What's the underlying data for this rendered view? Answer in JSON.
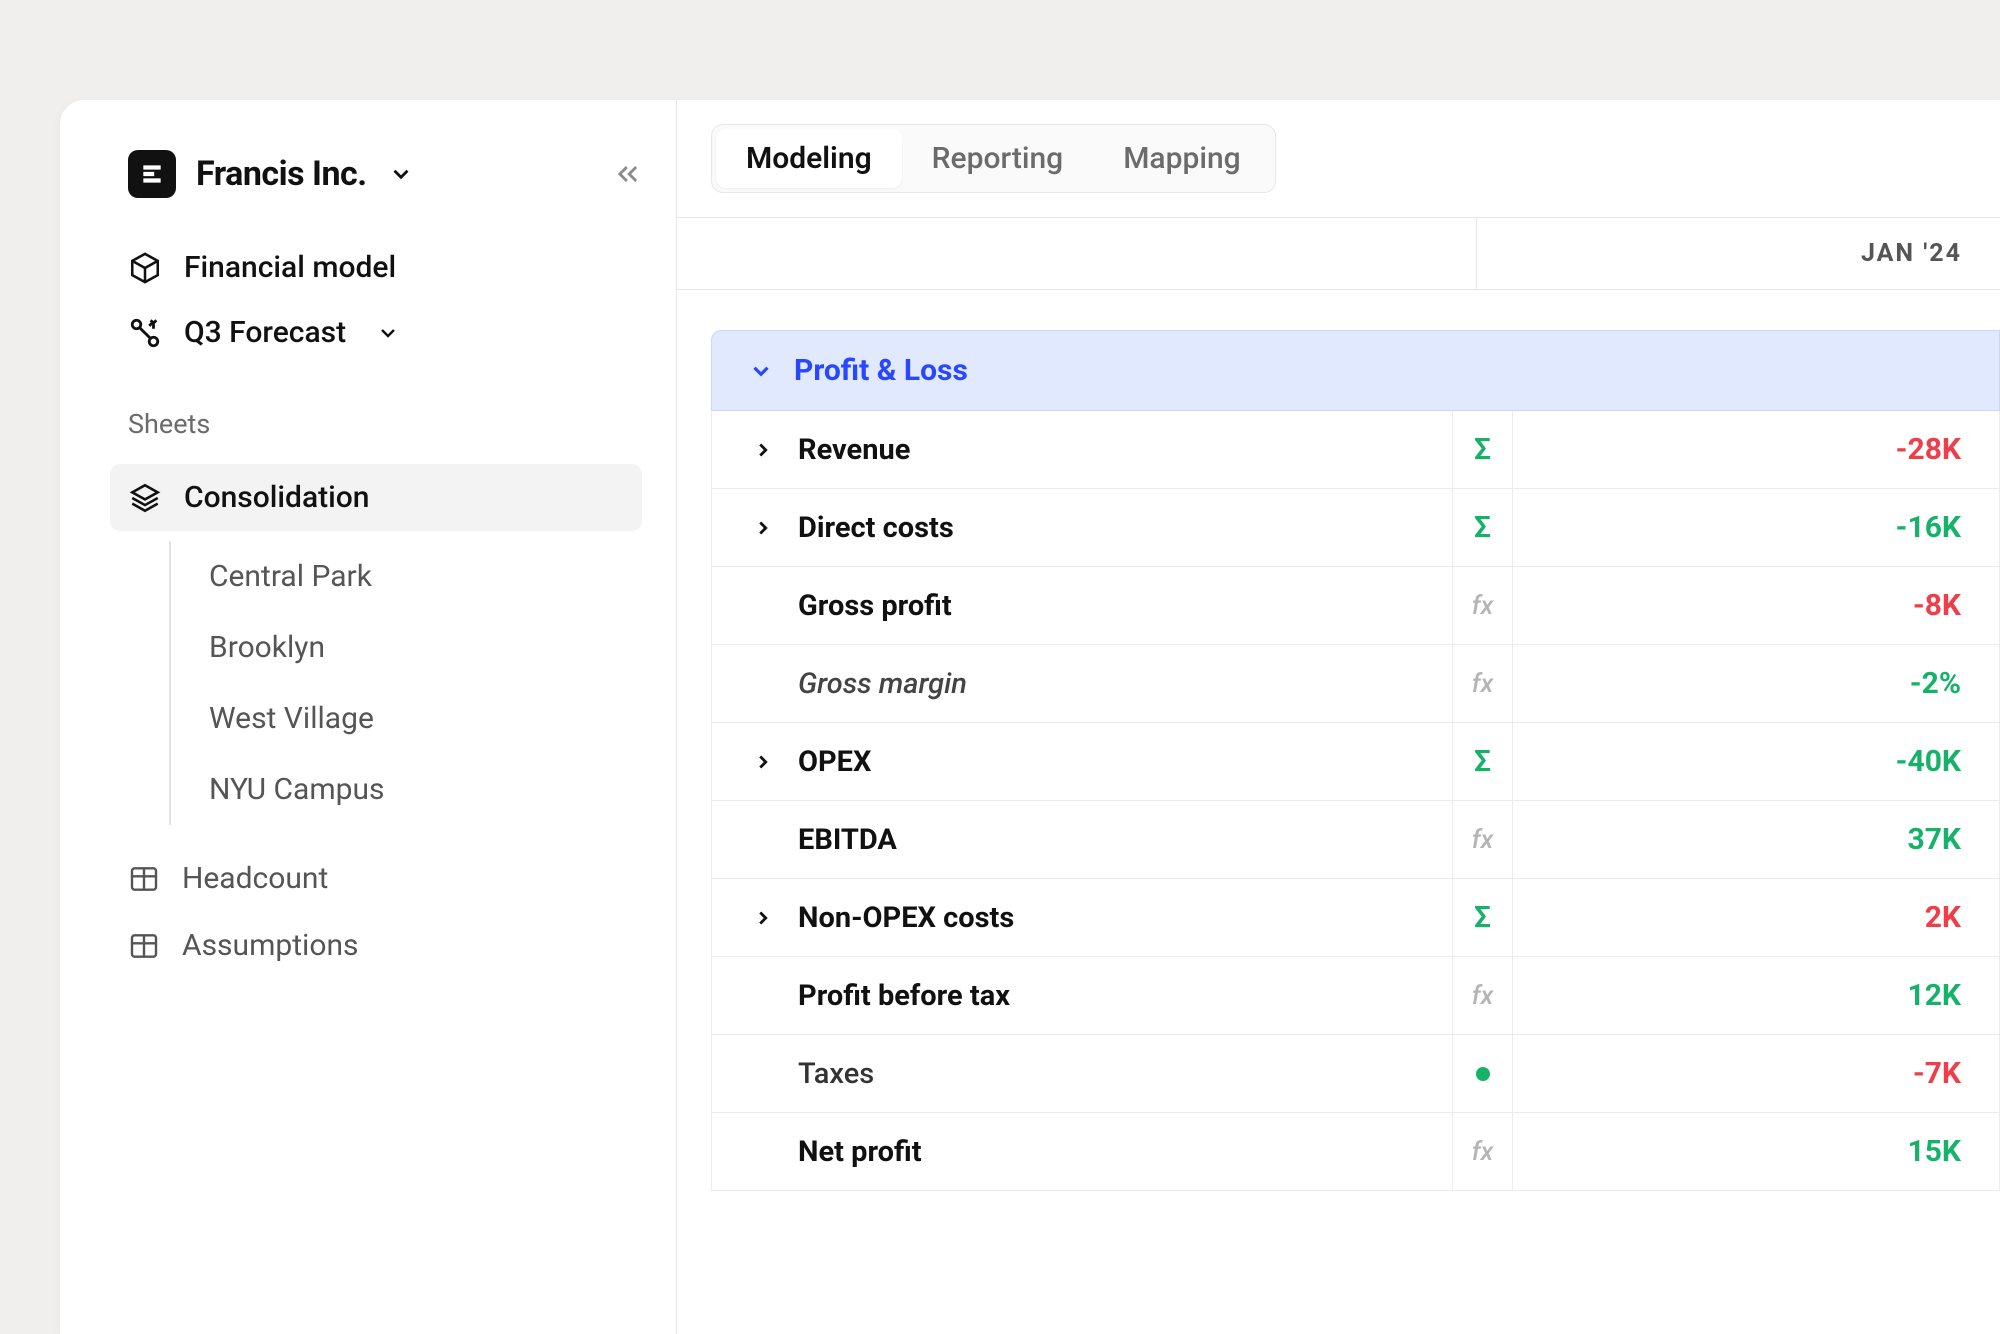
{
  "company": {
    "name": "Francis Inc."
  },
  "sidebar": {
    "model_label": "Financial model",
    "forecast_label": "Q3 Forecast",
    "sheets_heading": "Sheets",
    "consolidation_label": "Consolidation",
    "children": [
      "Central Park",
      "Brooklyn",
      "West Village",
      "NYU Campus"
    ],
    "headcount_label": "Headcount",
    "assumptions_label": "Assumptions"
  },
  "tabs": {
    "modeling": "Modeling",
    "reporting": "Reporting",
    "mapping": "Mapping"
  },
  "period": "JAN '24",
  "section": {
    "title": "Profit & Loss"
  },
  "rows": [
    {
      "label": "Revenue",
      "style": "bold",
      "chevron": true,
      "type": "sigma",
      "value": "-28K",
      "color": "neg"
    },
    {
      "label": "Direct costs",
      "style": "bold",
      "chevron": true,
      "type": "sigma",
      "value": "-16K",
      "color": "neg-green"
    },
    {
      "label": "Gross profit",
      "style": "bold",
      "chevron": false,
      "type": "fx",
      "value": "-8K",
      "color": "neg"
    },
    {
      "label": "Gross margin",
      "style": "italic",
      "chevron": false,
      "type": "fx",
      "value": "-2%",
      "color": "neg-green"
    },
    {
      "label": "OPEX",
      "style": "bold",
      "chevron": true,
      "type": "sigma",
      "value": "-40K",
      "color": "neg-green"
    },
    {
      "label": "EBITDA",
      "style": "bold",
      "chevron": false,
      "type": "fx",
      "value": "37K",
      "color": "pos"
    },
    {
      "label": "Non-OPEX costs",
      "style": "bold",
      "chevron": true,
      "type": "sigma",
      "value": "2K",
      "color": "neg"
    },
    {
      "label": "Profit before tax",
      "style": "bold",
      "chevron": false,
      "type": "fx",
      "value": "12K",
      "color": "pos"
    },
    {
      "label": "Taxes",
      "style": "normal",
      "chevron": false,
      "type": "dot",
      "value": "-7K",
      "color": "neg"
    },
    {
      "label": "Net profit",
      "style": "bold",
      "chevron": false,
      "type": "fx",
      "value": "15K",
      "color": "pos"
    }
  ]
}
